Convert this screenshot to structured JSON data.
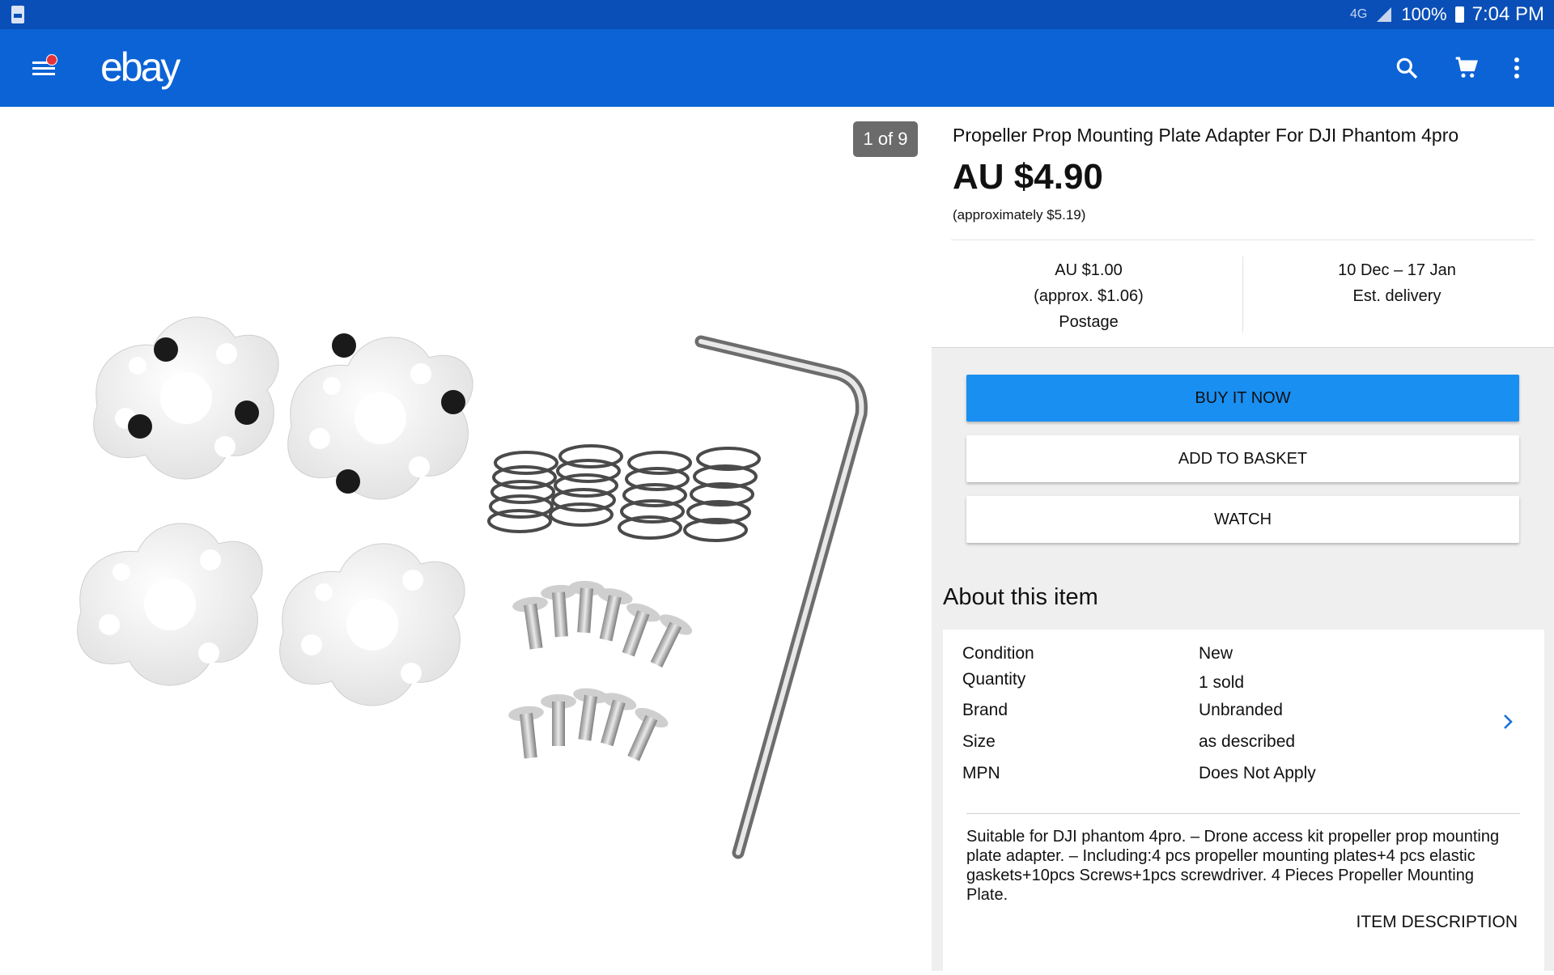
{
  "status_bar": {
    "network_label": "4G",
    "battery": "100%",
    "time": "7:04 PM"
  },
  "app_bar": {
    "logo": "ebay"
  },
  "image_viewer": {
    "counter": "1 of 9"
  },
  "listing": {
    "title": "Propeller Prop Mounting Plate Adapter For DJI Phantom 4pro",
    "price": "AU $4.90",
    "approx_price": "(approximately $5.19)",
    "postage": {
      "amount": "AU $1.00",
      "approx": "(approx. $1.06)",
      "label": "Postage"
    },
    "delivery": {
      "dates": "10 Dec – 17 Jan",
      "label": "Est. delivery"
    }
  },
  "actions": {
    "buy_now": "BUY IT NOW",
    "add_to_basket": "ADD TO BASKET",
    "watch": "WATCH"
  },
  "about": {
    "heading": "About this item",
    "specs": [
      {
        "label": "Condition",
        "value": "New"
      },
      {
        "label": "Quantity",
        "value": "1 sold"
      },
      {
        "label": "Brand",
        "value": "Unbranded"
      },
      {
        "label": "Size",
        "value": "as described"
      },
      {
        "label": "MPN",
        "value": "Does Not Apply"
      }
    ],
    "description": "Suitable for DJI phantom 4pro. – Drone access kit propeller prop mounting plate adapter. – Including:4 pcs propeller mounting plates+4 pcs elastic gaskets+10pcs Screws+1pcs screwdriver. 4 Pieces Propeller Mounting Plate.",
    "description_link": "ITEM DESCRIPTION"
  },
  "colors": {
    "status_bar": "#0a4fb8",
    "app_bar": "#0b63d6",
    "buy_button": "#1a8ff2",
    "panel_bg": "#efefef",
    "notification_dot": "#e53238"
  }
}
